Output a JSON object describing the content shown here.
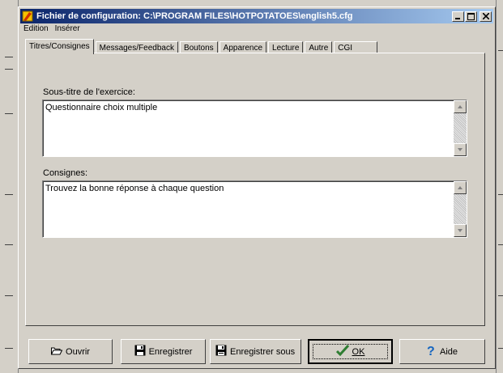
{
  "window": {
    "title": "Fichier de configuration: C:\\PROGRAM FILES\\HOTPOTATOES\\english5.cfg",
    "minimize_label": "_",
    "maximize_label": "□",
    "close_label": "×"
  },
  "menu": {
    "items": [
      {
        "label": "Edition"
      },
      {
        "label": "Insérer"
      }
    ]
  },
  "tabs": [
    {
      "label": "Titres/Consignes",
      "active": true
    },
    {
      "label": "Messages/Feedback"
    },
    {
      "label": "Boutons"
    },
    {
      "label": "Apparence"
    },
    {
      "label": "Lecture"
    },
    {
      "label": "Autre"
    },
    {
      "label": "CGI"
    }
  ],
  "fields": {
    "subtitle": {
      "label": "Sous-titre de l'exercice:",
      "value": "Questionnaire choix multiple"
    },
    "instructions": {
      "label": "Consignes:",
      "value": "Trouvez la bonne réponse à chaque question"
    }
  },
  "buttons": {
    "open": "Ouvrir",
    "save": "Enregistrer",
    "save_as": "Enregistrer sous",
    "ok": "OK",
    "help": "Aide"
  },
  "colors": {
    "face": "#d4d0c8",
    "titlebar_start": "#0a246a",
    "titlebar_end": "#a6caf0",
    "ok_check": "#2e7d32",
    "help_icon": "#1565c0"
  }
}
